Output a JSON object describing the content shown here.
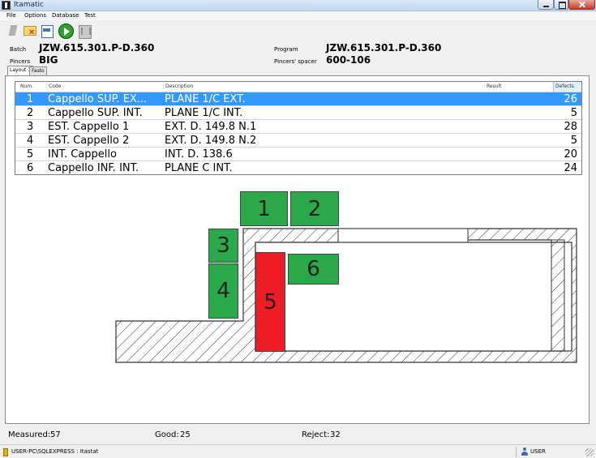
{
  "window": {
    "title": "Itamatic"
  },
  "menu": {
    "items": [
      "File",
      "Options",
      "Database",
      "Test"
    ]
  },
  "info": {
    "batch_label": "Batch",
    "batch_value": "JZW.615.301.P-D.360",
    "pincers_label": "Pincers",
    "pincers_value": "BIG",
    "program_label": "Program",
    "program_value": "JZW.615.301.P-D.360",
    "spacer_label": "Pincers' spacer",
    "spacer_value": "600-106"
  },
  "tabs": [
    "Layout 1",
    "Fasto"
  ],
  "grid": {
    "headers": {
      "num": "Num.",
      "code": "Code",
      "description": "Description",
      "result": "Result",
      "defects": "Defects"
    },
    "rows": [
      {
        "num": "1",
        "code": "Cappello SUP. EX...",
        "description": "PLANE 1/C EXT.",
        "result": "",
        "defects": "26"
      },
      {
        "num": "2",
        "code": "Cappello SUP. INT.",
        "description": "PLANE 1/C INT.",
        "result": "",
        "defects": "5"
      },
      {
        "num": "3",
        "code": "EST. Cappello 1",
        "description": "EXT. D. 149.8 N.1",
        "result": "",
        "defects": "28"
      },
      {
        "num": "4",
        "code": "EST. Cappello 2",
        "description": "EXT. D. 149.8 N.2",
        "result": "",
        "defects": "5"
      },
      {
        "num": "5",
        "code": "INT. Cappello",
        "description": "INT. D. 138.6",
        "result": "",
        "defects": "20"
      },
      {
        "num": "6",
        "code": "Cappello INF. INT.",
        "description": "PLANE C INT.",
        "result": "",
        "defects": "24"
      }
    ]
  },
  "drawing": {
    "zones": [
      {
        "label": "1",
        "status": "ok"
      },
      {
        "label": "2",
        "status": "ok"
      },
      {
        "label": "3",
        "status": "ok"
      },
      {
        "label": "4",
        "status": "ok"
      },
      {
        "label": "5",
        "status": "reject"
      },
      {
        "label": "6",
        "status": "ok"
      }
    ],
    "colors": {
      "ok": "#2aa84a",
      "reject": "#ee1c24"
    }
  },
  "stats": {
    "measured_label": "Measured:",
    "measured_value": "57",
    "good_label": "Good:",
    "good_value": "25",
    "reject_label": "Reject:",
    "reject_value": "32"
  },
  "statusbar": {
    "connection": "USER-PC\\SQLEXPRESS : Itastat",
    "user": "USER"
  },
  "colors": {
    "selection": "#3399ff",
    "titlebar": "#c3d7ee"
  }
}
